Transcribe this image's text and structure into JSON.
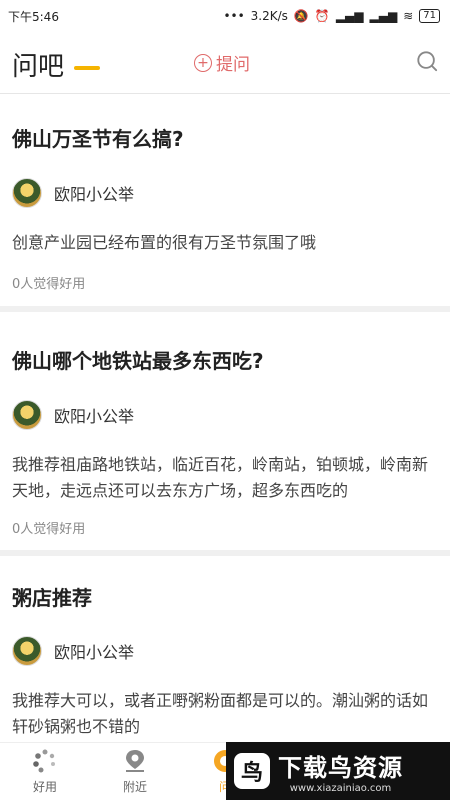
{
  "status_bar": {
    "time": "下午5:46",
    "network_speed": "3.2K/s",
    "battery": "71"
  },
  "header": {
    "title": "问吧",
    "ask_label": "提问"
  },
  "questions": [
    {
      "title": "佛山万圣节有么搞?",
      "author": "欧阳小公举",
      "answer": "创意产业园已经布置的很有万圣节氛围了哦",
      "helpful": "0人觉得好用"
    },
    {
      "title": "佛山哪个地铁站最多东西吃?",
      "author": "欧阳小公举",
      "answer": "我推荐祖庙路地铁站，临近百花，岭南站，铂顿城，岭南新天地，走远点还可以去东方广场，超多东西吃的",
      "helpful": "0人觉得好用"
    },
    {
      "title": "粥店推荐",
      "author": "欧阳小公举",
      "answer": "我推荐大可以，或者正嘢粥粉面都是可以的。潮汕粥的话如轩砂锅粥也不错的",
      "helpful": ""
    }
  ],
  "bottom_nav": {
    "items": [
      {
        "label": "好用"
      },
      {
        "label": "附近"
      },
      {
        "label": "问"
      }
    ]
  },
  "watermark": {
    "logo_char": "鸟",
    "title": "下载鸟资源",
    "url": "www.xiazainiao.com"
  },
  "colors": {
    "accent": "#f5a623",
    "ask": "#e06a6a",
    "underline": "#f5b400"
  }
}
